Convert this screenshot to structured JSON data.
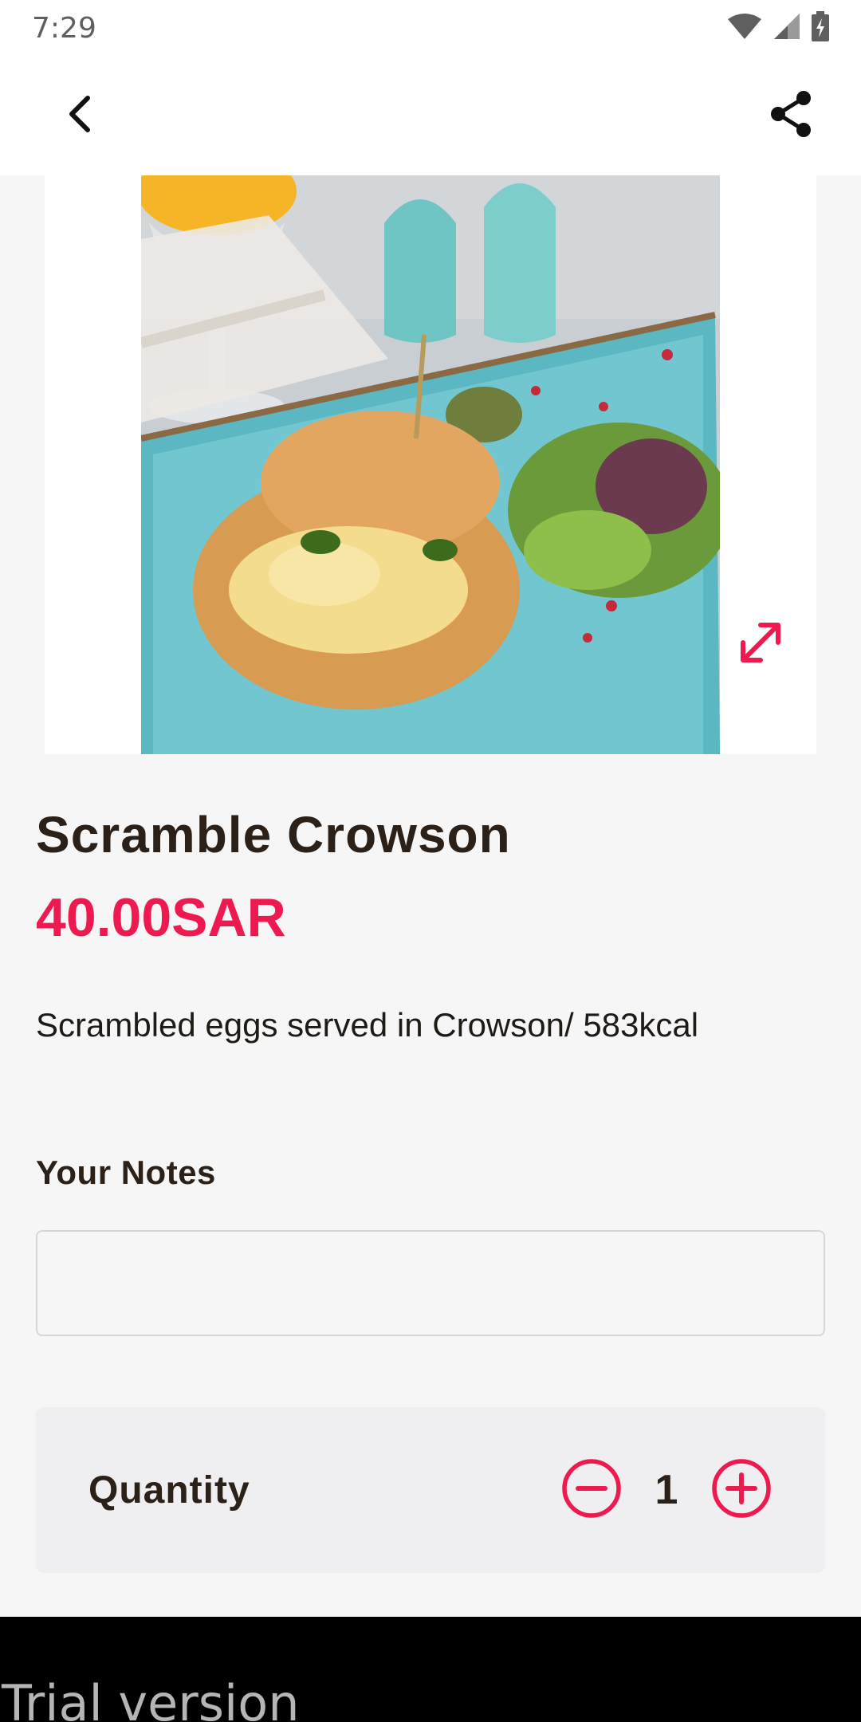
{
  "status_bar": {
    "time": "7:29",
    "icons": [
      "wifi-icon",
      "signal-icon",
      "battery-icon"
    ]
  },
  "toolbar": {
    "back_icon": "chevron-left-icon",
    "share_icon": "share-icon"
  },
  "product": {
    "image_alt": "Scramble Crowson",
    "name": "Scramble Crowson",
    "price": "40.00SAR",
    "description": "Scrambled eggs served in Crowson/ 583kcal",
    "expand_icon": "expand-icon"
  },
  "notes": {
    "label": "Your Notes",
    "value": "",
    "placeholder": ""
  },
  "quantity": {
    "label": "Quantity",
    "value": "1",
    "decrement_icon": "minus-circle-icon",
    "increment_icon": "plus-circle-icon"
  },
  "footer": {
    "trial_text": "Trial version"
  },
  "colors": {
    "accent": "#ee1a4f",
    "text": "#2b2118",
    "background": "#f7f6f6"
  }
}
